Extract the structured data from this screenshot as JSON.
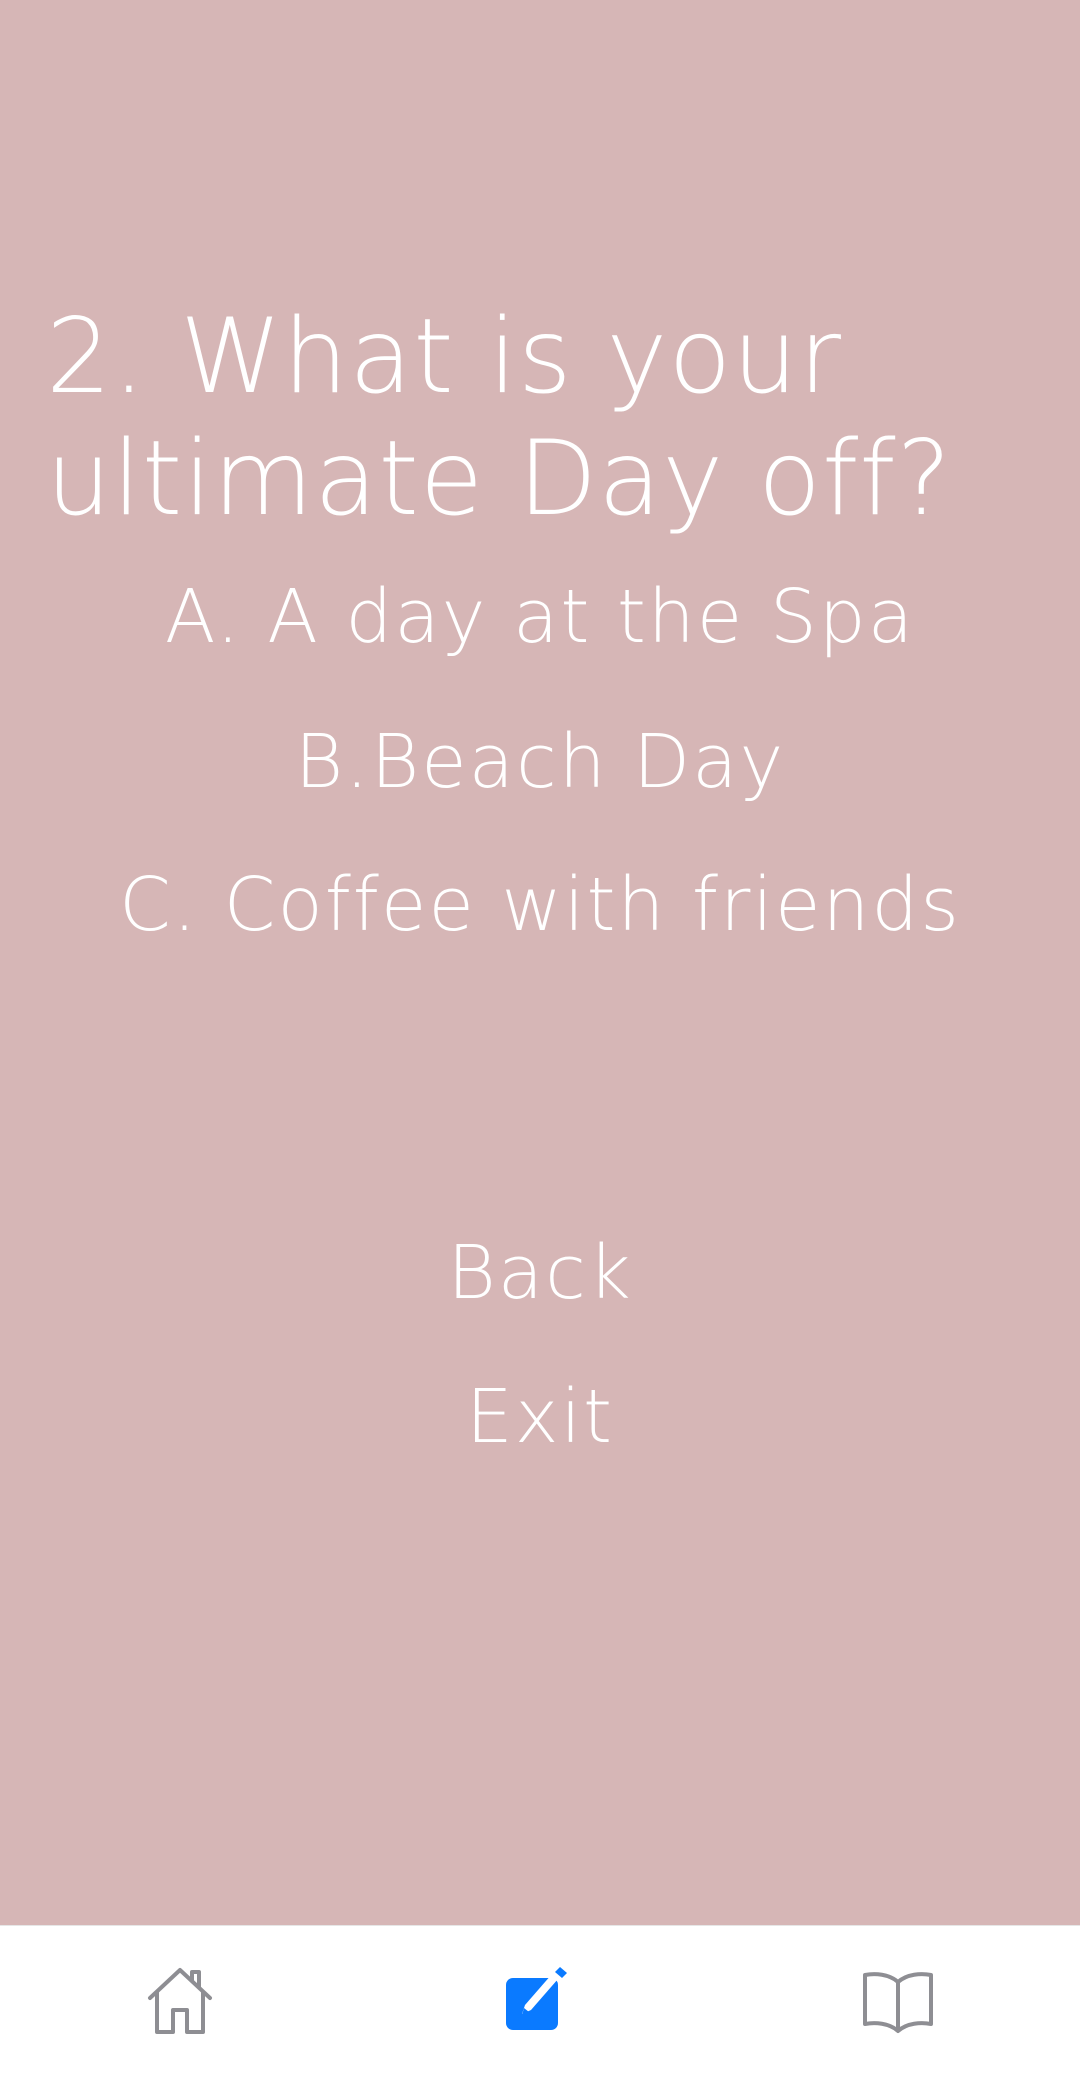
{
  "quiz": {
    "question": "2. What is your\nultimate Day off?",
    "options": [
      {
        "label": "A. A day at the Spa"
      },
      {
        "label": "B.Beach Day"
      },
      {
        "label": "C. Coffee with friends"
      }
    ],
    "back_label": "Back",
    "exit_label": "Exit"
  },
  "colors": {
    "background": "#d6b6b6",
    "text": "#ffffff",
    "tab_active": "#0a7aff",
    "tab_inactive": "#8e8e93"
  },
  "tabbar": {
    "tabs": [
      {
        "icon": "home-icon",
        "active": false
      },
      {
        "icon": "edit-icon",
        "active": true
      },
      {
        "icon": "book-icon",
        "active": false
      }
    ]
  }
}
